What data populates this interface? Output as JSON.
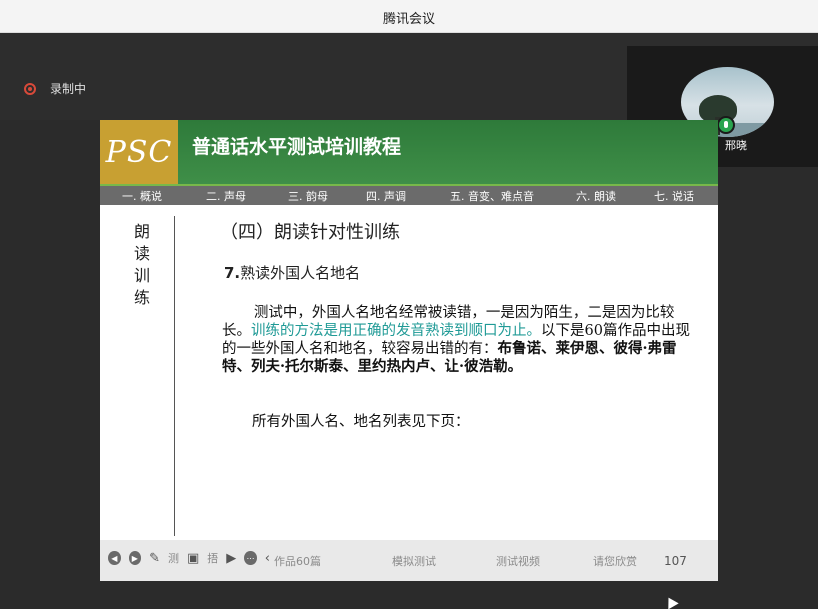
{
  "window": {
    "title": "腾讯会议"
  },
  "recording": {
    "label": "录制中"
  },
  "participant": {
    "name": "邢晓"
  },
  "slide": {
    "logo": "PSC",
    "banner_title": "普通话水平测试培训教程",
    "nav": [
      "一. 概说",
      "二. 声母",
      "三. 韵母",
      "四. 声调",
      "五. 音变、难点音",
      "六. 朗读",
      "七. 说话"
    ],
    "side_chars": [
      "朗",
      "读",
      "训",
      "练"
    ],
    "heading": "（四）朗读针对性训练",
    "subheading_num": "7.",
    "subheading_text": "熟读外国人名地名",
    "para": {
      "p1": "测试中，外国人名地名经常被读错，一是因为陌生，二是因为比较长。",
      "p1_hl": "训练的方法是用正确的发音熟读到顺口为止。",
      "p1_rest": "以下是60篇作品中出现的一些外国人名和地名，较容易出错的有：",
      "p1_bold": "布鲁诺、莱伊恩、彼得·弗雷特、列夫·托尔斯泰、里约热内卢、让·彼浩勒。"
    },
    "note": "所有外国人名、地名列表见下页：",
    "bottom_items": [
      "作品60篇",
      "模拟测试",
      "测试视频",
      "请您欣赏"
    ],
    "page_number": "107",
    "controls_partial": [
      "测",
      "捂"
    ]
  },
  "colors": {
    "banner": "#3a8a43",
    "logo_bg": "#c8a032",
    "nav_bg": "#6b6b6b",
    "highlight": "#1f9a96",
    "record": "#d84a3a"
  }
}
